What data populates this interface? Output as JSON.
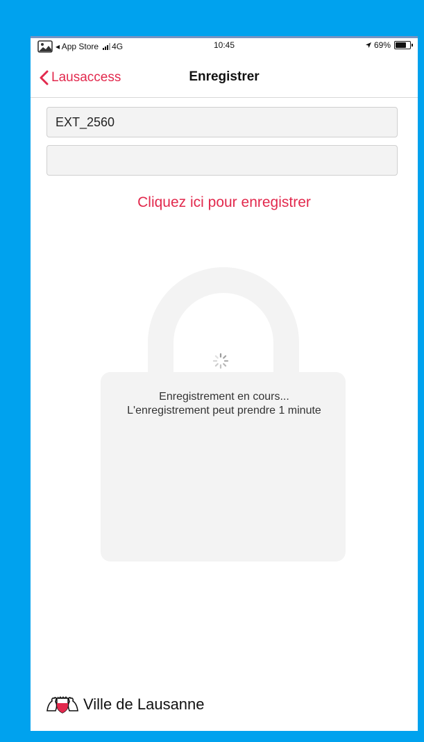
{
  "status_bar": {
    "carrier": "◂ App Store",
    "network": "4G",
    "time": "10:45",
    "battery": "69%"
  },
  "navbar": {
    "back_label": "Lausaccess",
    "title": "Enregistrer"
  },
  "form": {
    "username_value": "EXT_2560",
    "code_value": "",
    "register_link": "Cliquez ici pour enregistrer"
  },
  "progress": {
    "title": "Enregistrement en cours...",
    "subtitle": "L'enregistrement peut prendre 1 minute"
  },
  "footer": {
    "brand": "Ville de Lausanne"
  },
  "colors": {
    "accent": "#e2294d",
    "frame": "#00a2ee",
    "lock": "#f3f3f3"
  },
  "icons": [
    "photo-icon",
    "signal-icon",
    "location-arrow-icon",
    "battery-icon",
    "chevron-left-icon",
    "spinner-icon",
    "lausanne-crest-icon"
  ]
}
